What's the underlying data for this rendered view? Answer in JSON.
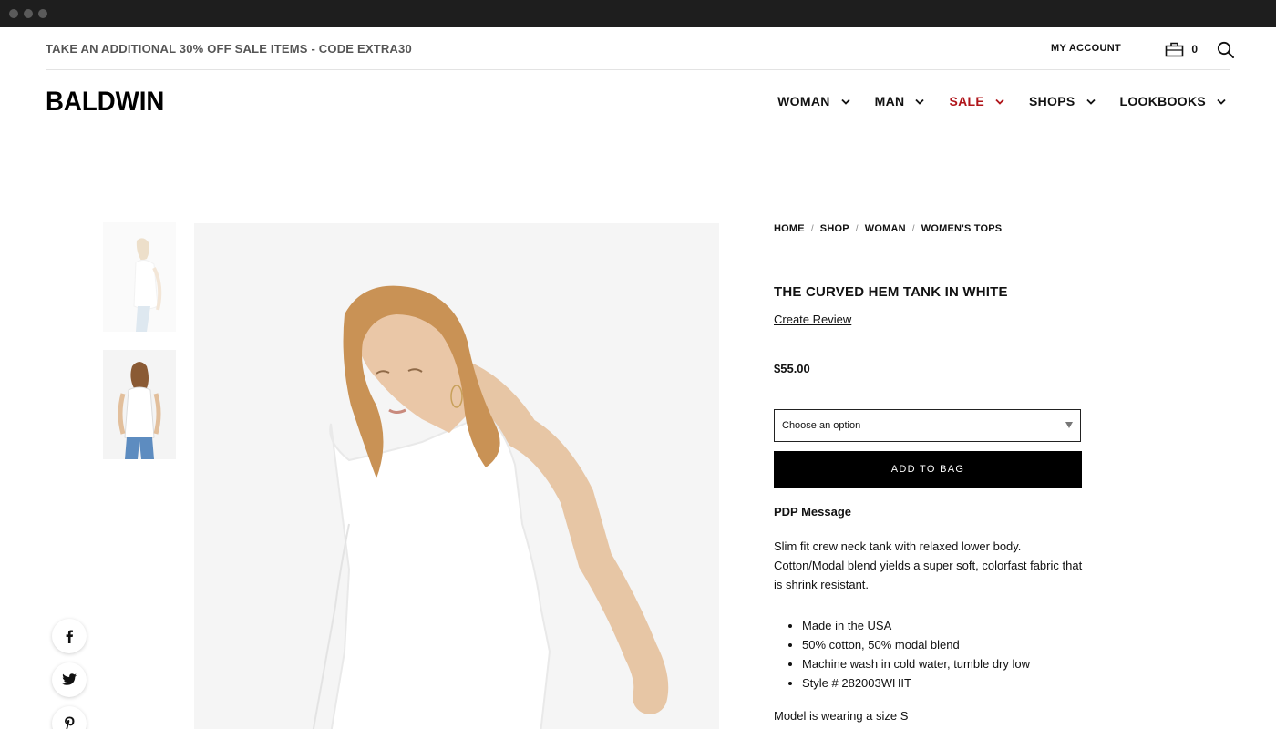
{
  "promo": {
    "text": "TAKE AN ADDITIONAL 30% OFF SALE ITEMS - CODE EXTRA30"
  },
  "header": {
    "my_account": "MY ACCOUNT",
    "bag_count": "0",
    "logo": "BALDWIN",
    "nav": [
      {
        "label": "WOMAN"
      },
      {
        "label": "MAN"
      },
      {
        "label": "SALE",
        "color": "#b0151a"
      },
      {
        "label": "SHOPS"
      },
      {
        "label": "LOOKBOOKS"
      }
    ]
  },
  "breadcrumb": [
    "HOME",
    "SHOP",
    "WOMAN",
    "WOMEN'S TOPS"
  ],
  "breadcrumb_separator": "/",
  "product": {
    "title": "THE CURVED HEM TANK IN WHITE",
    "review_link": "Create Review",
    "price": "$55.00",
    "option_select": "Choose an option",
    "add_button": "ADD TO BAG",
    "pdp_message": "PDP Message",
    "description": "Slim fit crew neck tank with relaxed lower body. Cotton/Modal blend yields a super soft, colorfast fabric that is shrink resistant.",
    "features": [
      "Made in the USA",
      "50% cotton, 50% modal blend",
      "Machine wash in cold water, tumble dry low",
      "Style # 282003WHIT"
    ],
    "model_note": "Model is wearing a size S"
  },
  "social": [
    "facebook-icon",
    "twitter-icon",
    "pinterest-icon"
  ],
  "colors": {
    "accent_sale": "#b0151a",
    "button": "#000000",
    "promo_text": "#555555"
  }
}
